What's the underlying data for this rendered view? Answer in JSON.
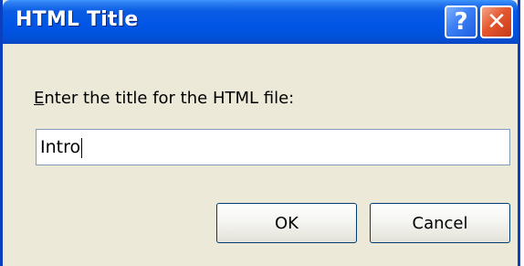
{
  "window": {
    "title": "HTML Title",
    "help_icon": "?",
    "close_icon": "✕"
  },
  "prompt": {
    "mnemonic": "E",
    "rest": "nter the title for the HTML file:"
  },
  "input": {
    "value": "Intro"
  },
  "buttons": {
    "ok_label": "OK",
    "cancel_label": "Cancel"
  },
  "colors": {
    "titlebar": "#0055e5",
    "dialog_background": "#ece9d8",
    "close_button": "#e4572e",
    "help_button": "#3b7ff5"
  }
}
